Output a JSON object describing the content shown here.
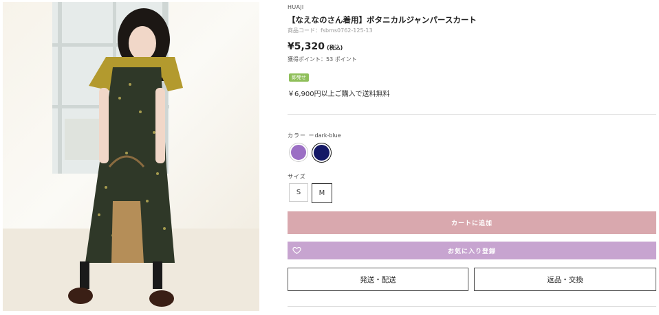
{
  "product": {
    "brand": "HUAJI",
    "title": "【なえなのさん着用】ボタニカルジャンパースカート",
    "code": "商品コード：fsbms0762-125-13",
    "price": "¥5,320",
    "tax_note": "(税込)",
    "points": "獲得ポイント：53 ポイント",
    "badge": "即発せ",
    "shipping_note": "￥6,900円以上ご購入で送料無料"
  },
  "color": {
    "label": "カラー",
    "separator": "ー",
    "selected": "dark-blue",
    "options": [
      {
        "name": "purple",
        "hex": "#9b6fc4"
      },
      {
        "name": "dark-blue",
        "hex": "#141866"
      }
    ]
  },
  "size": {
    "label": "サイズ",
    "options": [
      "S",
      "M"
    ],
    "selected": "M"
  },
  "actions": {
    "add_to_cart": "カートに追加",
    "add_to_favorites": "お気に入り登録",
    "shipping": "発送・配送",
    "returns": "返品・交換"
  },
  "icons": {
    "favorite": "heart-icon"
  },
  "colors": {
    "cart_button": "#d9a8ae",
    "favorite_button": "#c7a4d0",
    "badge": "#8fbf5a"
  }
}
